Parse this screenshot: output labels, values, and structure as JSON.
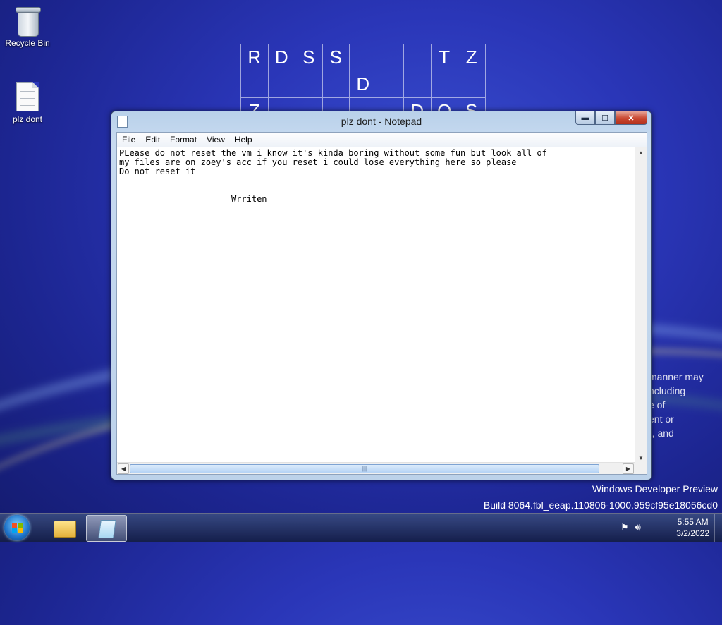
{
  "desktop": {
    "icons": [
      {
        "label": "Recycle Bin"
      },
      {
        "label": "plz dont"
      }
    ],
    "grid_rows": [
      [
        "R",
        "D",
        "S",
        "S",
        "",
        "",
        "",
        "T",
        "Z"
      ],
      [
        "",
        "",
        "",
        "",
        "D",
        "",
        "",
        "",
        ""
      ],
      [
        "Z",
        "",
        "",
        "",
        "",
        "",
        "D",
        "Q",
        "S"
      ]
    ],
    "eula_lines": [
      "manner may",
      "ncluding",
      "e of",
      "ent or",
      "), and"
    ],
    "watermark_line1": "Windows Developer Preview",
    "watermark_line2": "Build 8064.fbl_eeap.110806-1000.959cf95e18056cd0"
  },
  "window": {
    "title": "plz dont - Notepad",
    "caption_minimize": "▬",
    "caption_maximize": "☐",
    "caption_close": "✕",
    "menu": [
      "File",
      "Edit",
      "Format",
      "View",
      "Help"
    ],
    "content": "PLease do not reset the vm i know it's kinda boring without some fun but look all of\nmy files are on zoey's acc if you reset i could lose everything here so please\nDo not reset it\n\n\n                      Wrriten"
  },
  "taskbar": {
    "clock_time": "5:55 AM",
    "clock_date": "3/2/2022"
  },
  "icons": {
    "start": "windows-start-orb",
    "explorer": "folder-icon",
    "notepad": "notepad-icon",
    "action_center": "flag-icon",
    "volume": "speaker-icon"
  }
}
